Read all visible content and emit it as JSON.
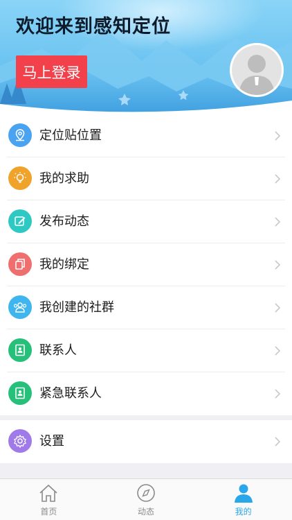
{
  "header": {
    "welcome": "欢迎来到感知定位",
    "login_label": "马上登录"
  },
  "menu": [
    {
      "label": "定位贴位置",
      "icon": "location-pin-icon",
      "color": "#4aa3f0"
    },
    {
      "label": "我的求助",
      "icon": "lightbulb-icon",
      "color": "#f0a32a"
    },
    {
      "label": "发布动态",
      "icon": "edit-icon",
      "color": "#2ec9c3"
    },
    {
      "label": "我的绑定",
      "icon": "copy-icon",
      "color": "#ef6f6f"
    },
    {
      "label": "我创建的社群",
      "icon": "group-icon",
      "color": "#3fb5ef"
    },
    {
      "label": "联系人",
      "icon": "contacts-book-icon",
      "color": "#27c07a"
    },
    {
      "label": "紧急联系人",
      "icon": "emergency-contacts-icon",
      "color": "#27c07a"
    }
  ],
  "settings": {
    "label": "设置",
    "icon": "gear-icon",
    "color": "#a07ae8"
  },
  "tabbar": [
    {
      "label": "首页",
      "icon": "home-icon",
      "active": false
    },
    {
      "label": "动态",
      "icon": "compass-icon",
      "active": false
    },
    {
      "label": "我的",
      "icon": "user-icon",
      "active": true
    }
  ],
  "colors": {
    "accent": "#2aa7e8",
    "login_button": "#f2414b"
  }
}
